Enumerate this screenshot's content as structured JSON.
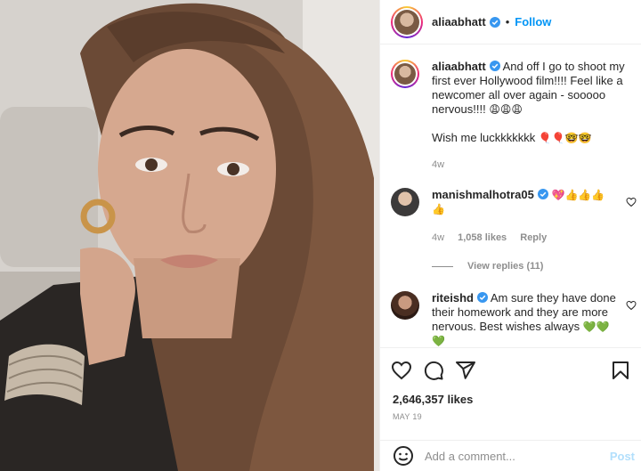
{
  "post": {
    "author": "aliaabhatt",
    "follow_label": "Follow",
    "dot": "•",
    "accent": "#0095f6",
    "verified_color": "#3897f0"
  },
  "caption": {
    "username": "aliaabhatt",
    "text": "And off I go to shoot my first ever Hollywood film!!!! Feel like a newcomer all over again - sooooo nervous!!!!",
    "emojis": "😩😩😩",
    "wish_text": "Wish me luckkkkkkk",
    "wish_emojis": "🎈🎈🤓🤓",
    "time": "4w"
  },
  "comments": [
    {
      "username": "manishmalhotra05",
      "emojis_line1": "💖👍👍👍",
      "emojis_line2": "👍",
      "time": "4w",
      "likes": "1,058 likes",
      "reply_label": "Reply",
      "view_replies": "View replies (11)"
    },
    {
      "username": "riteishd",
      "text": "Am sure they have done their homework and they are more nervous. Best wishes always",
      "emojis": "💚💚",
      "emojis_line2": "💚"
    }
  ],
  "stats": {
    "likes": "2,646,357 likes",
    "date": "MAY 19"
  },
  "add_comment": {
    "placeholder": "Add a comment...",
    "post_label": "Post"
  },
  "icons": [
    "heart-icon",
    "comment-icon",
    "share-icon",
    "bookmark-icon",
    "emoji-icon",
    "verified-badge-icon"
  ]
}
